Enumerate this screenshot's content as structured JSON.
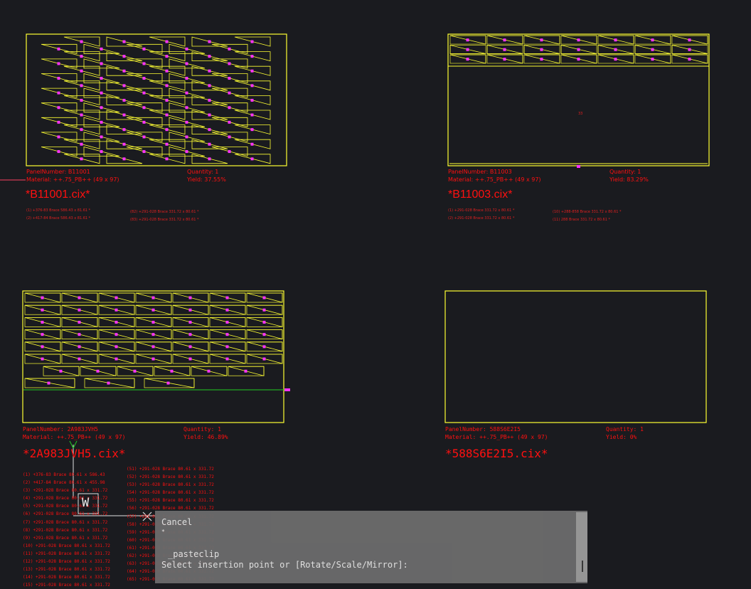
{
  "colors": {
    "background": "#1a1b1f",
    "panel_outline": "#ffff33",
    "part_outline": "#ffff33",
    "label_marker": "#ff33ff",
    "annotation": "#ff1010",
    "alignment_line": "#22cc22",
    "command_bg": "#6b6b6b"
  },
  "panels": [
    {
      "panel_number": "PanelNumber: B11001",
      "material": "Material: ++.75_PB++ (49 x 97)",
      "quantity": "Quantity: 1",
      "yield": "Yield: 37.55%",
      "file": "*B11001.cix*",
      "notes": [
        "(1) +376-83 Brace 586.43 x 81.61 *",
        "(2) +417-84 Brace 586.43 x 81.61 *",
        "(82) +291-028 Brace 331.72 x 80.61 *",
        "(83) +291-028 Brace 331.72 x 80.61 *"
      ]
    },
    {
      "panel_number": "PanelNumber: B11003",
      "material": "Material: ++.75_PB++ (49 x 97)",
      "quantity": "Quantity: 1",
      "yield": "Yield: 83.29%",
      "file": "*B11003.cix*",
      "center_label": "33",
      "notes": [
        "(1) +291-028 Brace 331.72 x 80.61 *",
        "(2) +291-028 Brace 331.72 x 80.61 *",
        "(10) +288-858 Brace 331.72 x 80.61 *",
        "(11) 288 Brace 331.72 x 80.61 *"
      ]
    },
    {
      "panel_number": "PanelNumber: 2A983JVH5",
      "material": "Material: ++.75_PB++ (49 x 97)",
      "quantity": "Quantity: 1",
      "yield": "Yield: 46.89%",
      "file": "*2A983JVH5.cix*"
    },
    {
      "panel_number": "PanelNumber: 588S6E2I5",
      "material": "Material: ++.75_PB++ (49 x 97)",
      "quantity": "Quantity: 1",
      "yield": "Yield: 0%",
      "file": "*588S6E2I5.cix*"
    }
  ],
  "parts_list_left": [
    "(1) +376-83 Brace 80.61 x 586.43",
    "(2) +417-84 Brace 80.61 x 455.98",
    "(3) +291-028 Brace 80.61 x 331.72",
    "(4) +291-028 Brace 80.61 x 331.72",
    "(5) +291-028 Brace 80.61 x 331.72",
    "(6) +291-028 Brace 80.61 x 331.72",
    "(7) +291-028 Brace 80.61 x 331.72",
    "(8) +291-028 Brace 80.61 x 331.72",
    "(9) +291-028 Brace 80.61 x 331.72",
    "(10) +291-028 Brace 80.61 x 331.72",
    "(11) +291-028 Brace 80.61 x 331.72",
    "(12) +291-028 Brace 80.61 x 331.72",
    "(13) +291-028 Brace 80.61 x 331.72",
    "(14) +291-028 Brace 80.61 x 331.72",
    "(15) +291-028 Brace 80.61 x 331.72"
  ],
  "parts_list_right": [
    "(51) +291-028 Brace 80.61 x 331.72",
    "(52) +291-028 Brace 80.61 x 331.72",
    "(53) +291-028 Brace 80.61 x 331.72",
    "(54) +291-028 Brace 80.61 x 331.72",
    "(55) +291-028 Brace 80.61 x 331.72",
    "(56) +291-028 Brace 80.61 x 331.72",
    "(57) +291-028 Brace 80.61 x 331.72",
    "(58) +291-028 Brace 80.61 x 331.72",
    "(59) +291-028 Brace 80.61 x 331.72",
    "(60) +291-028 Brace 80.61 x 331.72",
    "(61) +291-028 Brace 80.61 x 331.72",
    "(62) +291-028 Brace 80.61 x 331.72",
    "(63) +291-028 Brace 80.61 x 331.72",
    "(64) +291-028 Brace 80.61 x 331.72",
    "(65) +291-028 Brace 80.61 x 331.72"
  ],
  "ucs_label": "W",
  "command": {
    "history": [
      "Cancel",
      "*",
      "_pasteclip"
    ],
    "prompt": "Select insertion point or [Rotate/Scale/Mirror]:"
  }
}
